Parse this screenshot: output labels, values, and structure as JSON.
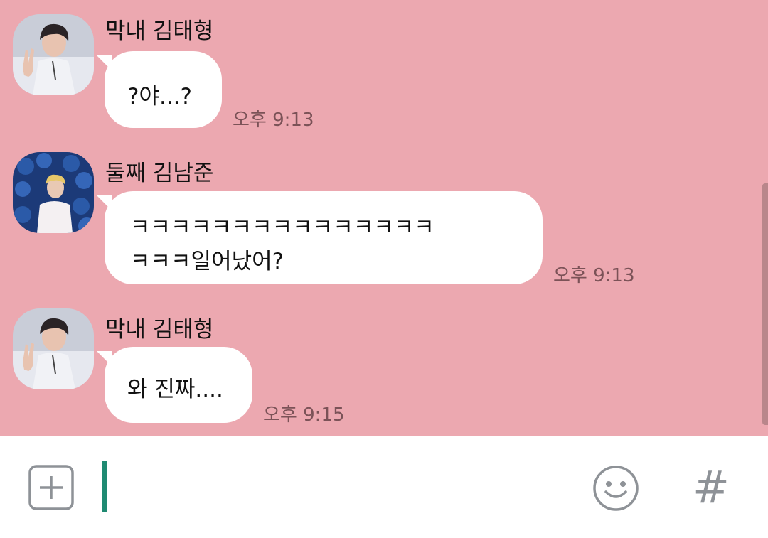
{
  "messages": [
    {
      "sender": "막내 김태형",
      "text": "?야...?",
      "time": "오후 9:13",
      "avatar": "avatar-v"
    },
    {
      "sender": "둘째 김남준",
      "text": "ㅋㅋㅋㅋㅋㅋㅋㅋㅋㅋㅋㅋㅋㅋㅋ\nㅋㅋㅋ일어났어?",
      "time": "오후 9:13",
      "avatar": "avatar-rm"
    },
    {
      "sender": "막내 김태형",
      "text": "와 진짜....",
      "time": "오후 9:15",
      "avatar": "avatar-v"
    }
  ],
  "input": {
    "value": "",
    "plus_icon": "plus-square-icon",
    "emoji_icon": "smiley-icon",
    "hash_label": "#"
  },
  "colors": {
    "background": "#eca8b0",
    "bubble": "#ffffff",
    "cursor": "#1f8a72",
    "icon": "#8e9297"
  }
}
